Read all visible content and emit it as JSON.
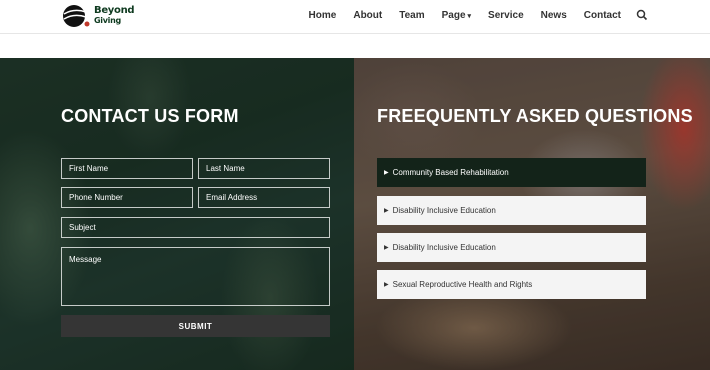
{
  "brand": {
    "logo_line1": "Beyond",
    "logo_line2": "Giving"
  },
  "nav": {
    "items": [
      "Home",
      "About",
      "Team",
      "Page",
      "Service",
      "News",
      "Contact"
    ],
    "page_caret": "▾",
    "search_icon": "search-icon"
  },
  "contact_form": {
    "title": "CONTACT US FORM",
    "first_name_placeholder": "First Name",
    "last_name_placeholder": "Last Name",
    "phone_placeholder": "Phone Number",
    "email_placeholder": "Email Address",
    "subject_placeholder": "Subject",
    "message_placeholder": "Message",
    "submit_label": "SUBMIT"
  },
  "faq": {
    "title": "FREEQUENTLY ASKED QUESTIONS",
    "items": [
      {
        "label": "Community Based Rehabilitation",
        "active": true
      },
      {
        "label": "Disability Inclusive Education",
        "active": false
      },
      {
        "label": "Disability Inclusive Education",
        "active": false
      },
      {
        "label": "Sexual Reproductive Health and Rights",
        "active": false
      }
    ],
    "arrow": "▶"
  },
  "colors": {
    "brand_green": "#0e3a1f",
    "faq_active_bg": "#132319",
    "submit_bg": "#353535"
  }
}
